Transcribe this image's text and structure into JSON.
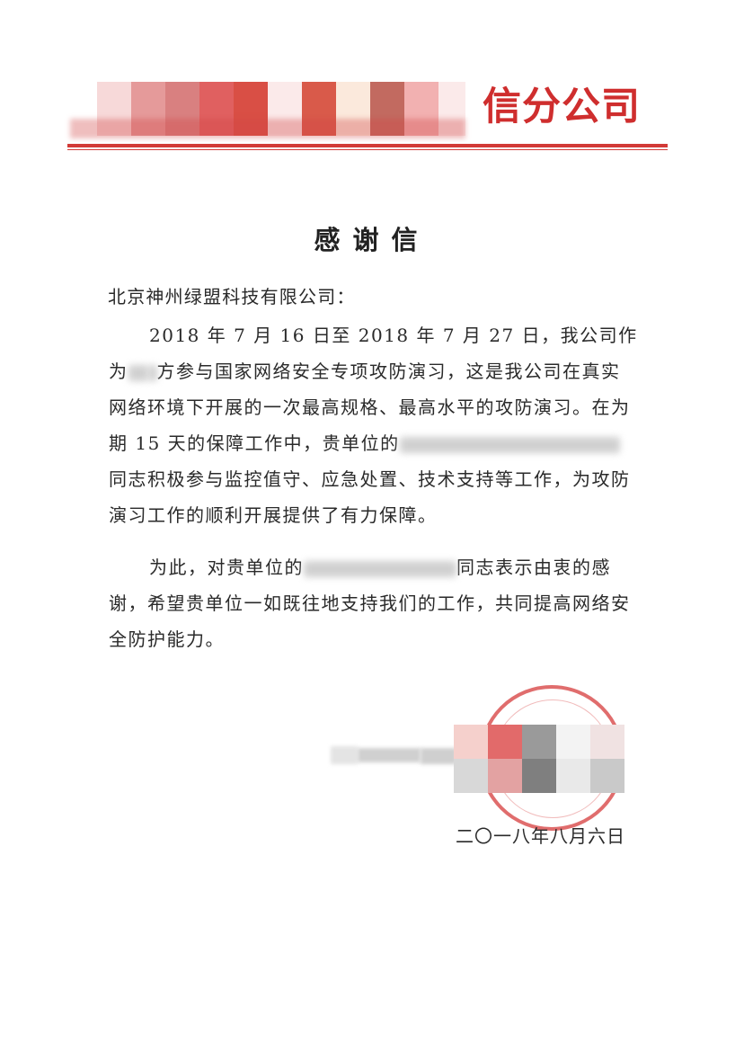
{
  "letterhead": {
    "company_name_visible": "信分公司",
    "accent_color": "#d23a37"
  },
  "title": "感谢信",
  "recipient": "北京神州绿盟科技有限公司：",
  "paragraphs": {
    "p1_a": "2018 年 7 月 16 日至 2018 年 7 月 27 日，我公司作为",
    "p1_b": "方参与国家网络安全专项攻防演习，这是我公司在真实网络环境下开展的一次最高规格、最高水平的攻防演习。在为期 15 天的保障工作中，贵单位的",
    "p1_c": "同志积极参与监控值守、应急处置、技术支持等工作，为攻防演习工作的顺利开展提供了有力保障。",
    "p2_a": "为此，对贵单位的",
    "p2_b": "同志表示由衷的感谢，希望贵单位一如既往地支持我们的工作，共同提高网络安全防护能力。"
  },
  "date": "二〇一八年八月六日",
  "seal": {
    "color": "#d63c3c",
    "icon": "star-icon"
  }
}
